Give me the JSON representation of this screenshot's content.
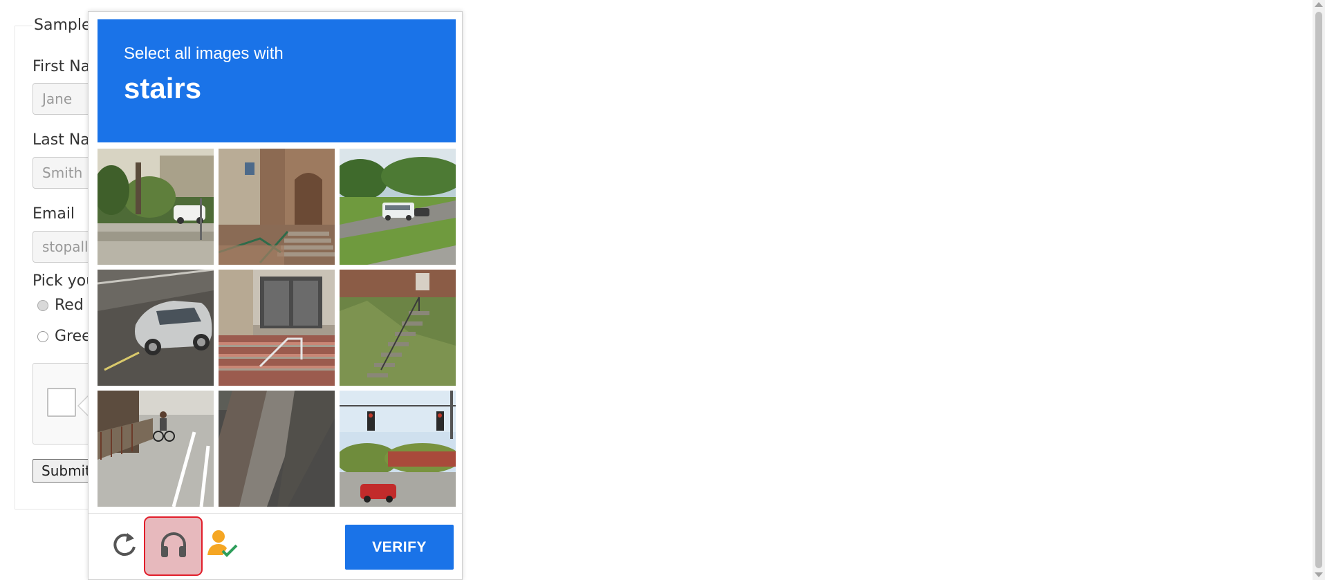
{
  "form": {
    "legend": "Sample",
    "first_name_label": "First Nar",
    "first_name_placeholder": "Jane",
    "last_name_label": "Last Nar",
    "last_name_placeholder": "Smith",
    "email_label": "Email",
    "email_placeholder": "stopallb",
    "color_label": "Pick you",
    "color_options": [
      "Red",
      "Greer"
    ],
    "submit_label": "Submit"
  },
  "challenge": {
    "instruction": "Select all images with",
    "keyword": "stairs",
    "tiles": [
      {
        "scene": "street-trees-car"
      },
      {
        "scene": "brick-building-stairs"
      },
      {
        "scene": "road-bus-grass"
      },
      {
        "scene": "silver-car-road"
      },
      {
        "scene": "building-entrance-stairs"
      },
      {
        "scene": "grass-slope-stairs"
      },
      {
        "scene": "crosswalk-cyclist"
      },
      {
        "scene": "asphalt-sidewalk"
      },
      {
        "scene": "traffic-lights-car"
      }
    ],
    "reload_icon": "reload-icon",
    "audio_icon": "headphones-icon",
    "info_icon": "user-check-icon",
    "verify_label": "VERIFY"
  },
  "colors": {
    "accent": "#1a73e8",
    "audio_highlight_border": "#e11d2a",
    "audio_highlight_fill": "#e7b9bd",
    "info_icon_orange": "#f5a623",
    "info_icon_green": "#2e9e5b"
  }
}
